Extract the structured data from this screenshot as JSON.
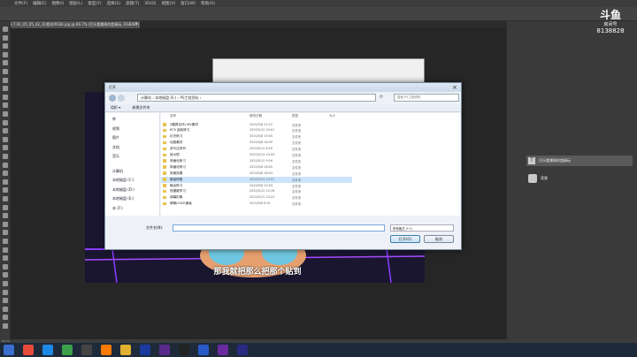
{
  "menubar": {
    "items": [
      "文件(F)",
      "编辑(E)",
      "图像(I)",
      "图层(L)",
      "类型(Y)",
      "选择(S)",
      "滤镜(T)",
      "3D(D)",
      "视图(V)",
      "窗口(W)",
      "帮助(H)"
    ]
  },
  "document": {
    "tab_title": "3.7.91_05_05_42_31素材(RGB).jpg @ 66.7% (巴乐看爆周的超精玩, RGB/8#)",
    "zoom": "66.7%"
  },
  "watermark": {
    "brand": "斗鱼",
    "sub": "房间号",
    "room": "8138828"
  },
  "open_dialog": {
    "title": "打开",
    "address": "计算机 › 本地磁盘 (E:) › PS工程资料 ›",
    "search_placeholder": "搜索 PS工程资料",
    "toolbar_organize": "组织 ▾",
    "toolbar_new_folder": "新建文件夹",
    "columns": {
      "name": "名称",
      "date": "修改日期",
      "type": "类型",
      "size": "大小"
    },
    "tree": [
      {
        "label": "库"
      },
      {
        "label": "视频"
      },
      {
        "label": "图片"
      },
      {
        "label": "文档"
      },
      {
        "label": "音乐"
      },
      {
        "label": "计算机"
      },
      {
        "label": "本地磁盘 (C:)"
      },
      {
        "label": "本地磁盘 (D:)"
      },
      {
        "label": "本地磁盘 (E:)"
      },
      {
        "label": "本 (F:)"
      }
    ],
    "files": [
      {
        "name": "2模具合作)  MV素材",
        "date": "2020/5/8 15:15",
        "type": "文件夹"
      },
      {
        "name": "675 曲线练习",
        "date": "2020/5/12 20:01",
        "type": "文件夹"
      },
      {
        "name": "灯光练习",
        "date": "2020/5/8 15:05",
        "type": "文件夹"
      },
      {
        "name": "动感素材",
        "date": "2020/5/8 18:09",
        "type": "文件夹"
      },
      {
        "name": "多代达系列",
        "date": "2020/5/12 8:16",
        "type": "文件夹"
      },
      {
        "name": "放大镜",
        "date": "2020/5/12 10:09",
        "type": "文件夹"
      },
      {
        "name": "风格化练习",
        "date": "2020/5/12 9:16",
        "type": "文件夹"
      },
      {
        "name": "风格化练习",
        "date": "2020/5/8 18:05",
        "type": "文件夹"
      },
      {
        "name": "风景效果",
        "date": "2020/5/8 18:03",
        "type": "文件夹"
      },
      {
        "name": "服装修整",
        "date": "2020/5/12 23:01",
        "type": "文件夹"
      },
      {
        "name": "输出练习",
        "date": "2020/5/8 15:04",
        "type": "文件夹"
      },
      {
        "name": "快捷键学习",
        "date": "2020/5/12 15:26",
        "type": "文件夹"
      },
      {
        "name": "绿幕扣像",
        "date": "2020/5/12 23:23",
        "type": "文件夹"
      },
      {
        "name": "萌萌LOGO速画",
        "date": "2020/5/8 8:01",
        "type": "文件夹"
      }
    ],
    "selected_index": 9,
    "filename_label": "文件名(N):",
    "filename_value": "",
    "filetype_value": "所有格式 (*.*)",
    "open_button": "打开(O)",
    "cancel_button": "取消"
  },
  "subtitle": "那我就把那么把那个贴到",
  "layers": [
    {
      "name": "巴乐看爆周的超精玩",
      "kind": "T"
    },
    {
      "name": "背景",
      "kind": "image"
    }
  ],
  "colors": {
    "accent": "#3c7fb1",
    "folder": "#e8c24a",
    "neon": "#8b3cff"
  }
}
